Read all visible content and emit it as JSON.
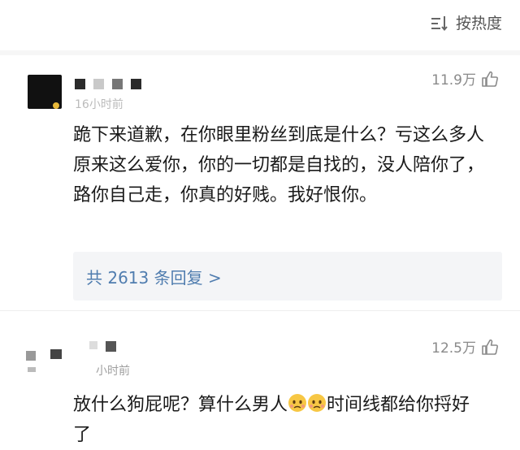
{
  "sort": {
    "label": "按热度",
    "icon": "sort-lines-icon"
  },
  "comments": [
    {
      "time": "16小时前",
      "likes": "11.9万",
      "text": "跪下来道歉，在你眼里粉丝到底是什么？亏这么多人原来这么爱你，你的一切都是自找的，没人陪你了，路你自己走，你真的好贱。我好恨你。",
      "reply_label": "共 2613 条回复 >"
    },
    {
      "time": "小时前",
      "likes": "12.5万",
      "text_part1": "放什么狗屁呢？算什么男人",
      "text_part2": "时间线都给你捋好了"
    }
  ],
  "colors": {
    "link": "#507daf",
    "muted": "#8a8a8a",
    "reply_bg": "#f4f5f7"
  }
}
